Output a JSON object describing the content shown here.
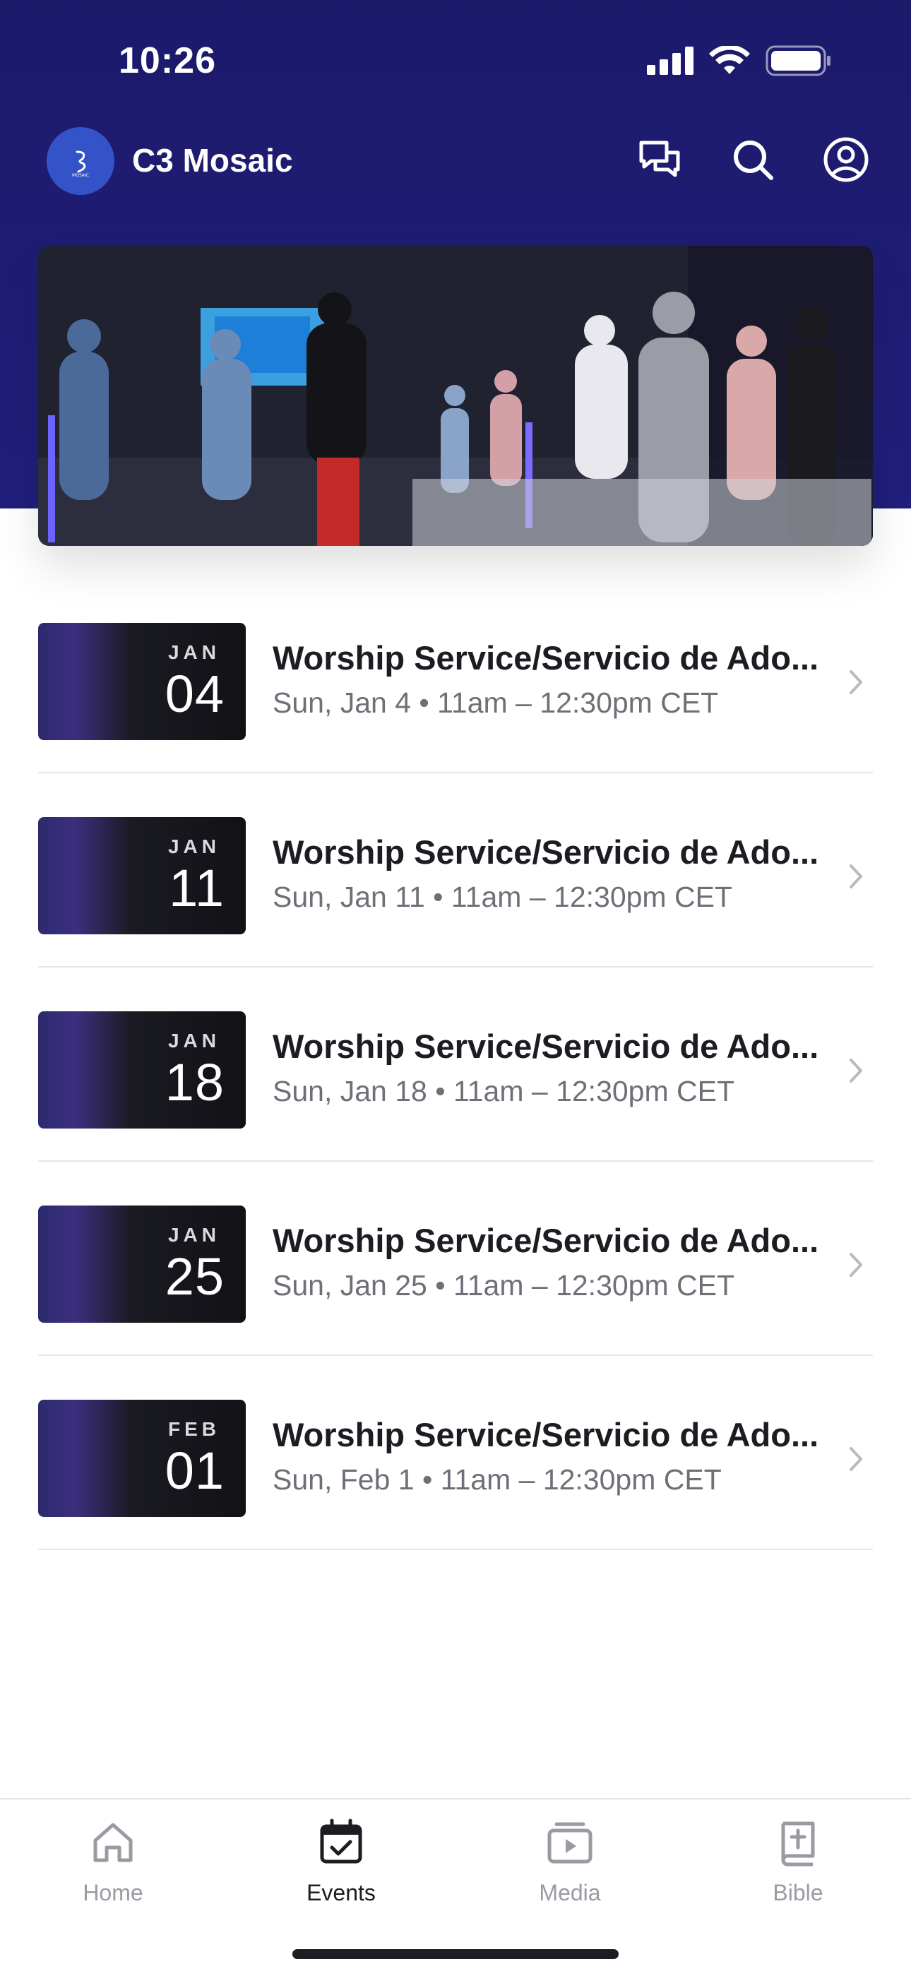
{
  "status_bar": {
    "time": "10:26"
  },
  "header": {
    "app_title": "C3 Mosaic",
    "actions": [
      "chat-icon",
      "search-icon",
      "account-icon"
    ]
  },
  "events": [
    {
      "month": "JAN",
      "day": "04",
      "title": "Worship Service/Servicio de Ado...",
      "meta": "Sun, Jan 4 • 11am – 12:30pm CET"
    },
    {
      "month": "JAN",
      "day": "11",
      "title": "Worship Service/Servicio de Ado...",
      "meta": "Sun, Jan 11 • 11am – 12:30pm CET"
    },
    {
      "month": "JAN",
      "day": "18",
      "title": "Worship Service/Servicio de Ado...",
      "meta": "Sun, Jan 18 • 11am – 12:30pm CET"
    },
    {
      "month": "JAN",
      "day": "25",
      "title": "Worship Service/Servicio de Ado...",
      "meta": "Sun, Jan 25 • 11am – 12:30pm CET"
    },
    {
      "month": "FEB",
      "day": "01",
      "title": "Worship Service/Servicio de Ado...",
      "meta": "Sun, Feb 1 • 11am – 12:30pm CET"
    }
  ],
  "tabs": [
    {
      "label": "Home",
      "icon": "home-icon",
      "active": false
    },
    {
      "label": "Events",
      "icon": "calendar-check-icon",
      "active": true
    },
    {
      "label": "Media",
      "icon": "media-play-icon",
      "active": false
    },
    {
      "label": "Bible",
      "icon": "bible-icon",
      "active": false
    }
  ],
  "colors": {
    "header_bg": "#1f1c74",
    "accent_logo": "#3553c9",
    "text_primary": "#1c1c22",
    "text_secondary": "#6f6f78"
  }
}
